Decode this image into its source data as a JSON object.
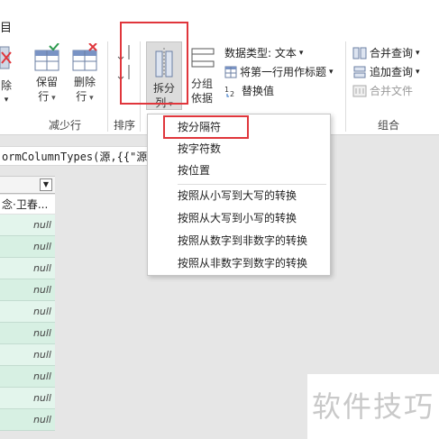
{
  "ribbon": {
    "tab_fragment": "目",
    "buttons": {
      "remove_fragment": "除",
      "keep_rows": [
        "保留",
        "行"
      ],
      "delete_rows": [
        "删除",
        "行"
      ],
      "split_column": [
        "拆分",
        "列"
      ],
      "group_by": [
        "分组",
        "依据"
      ]
    },
    "transform": {
      "data_type": "数据类型: 文本",
      "first_row_header": "将第一行用作标题",
      "replace_values": "替换值"
    },
    "combine": {
      "merge_queries": "合并查询",
      "append_queries": "追加查询",
      "combine_files": "合并文件"
    },
    "groups": {
      "reduce_rows": "减少行",
      "sort": "排序",
      "combine": "组合"
    }
  },
  "formula": {
    "text": "ormColumnTypes(源,{{\"源数"
  },
  "column": {
    "first_cell": "念·卫春...",
    "null_label": "null",
    "null_count": 10
  },
  "menu": {
    "items": [
      "按分隔符",
      "按字符数",
      "按位置",
      "按照从小写到大写的转换",
      "按照从大写到小写的转换",
      "按照从数字到非数字的转换",
      "按照从非数字到数字的转换"
    ]
  },
  "watermark": "软件技巧",
  "colors": {
    "highlight_box": "#e0363c",
    "null_row": "#d7f0e3"
  }
}
